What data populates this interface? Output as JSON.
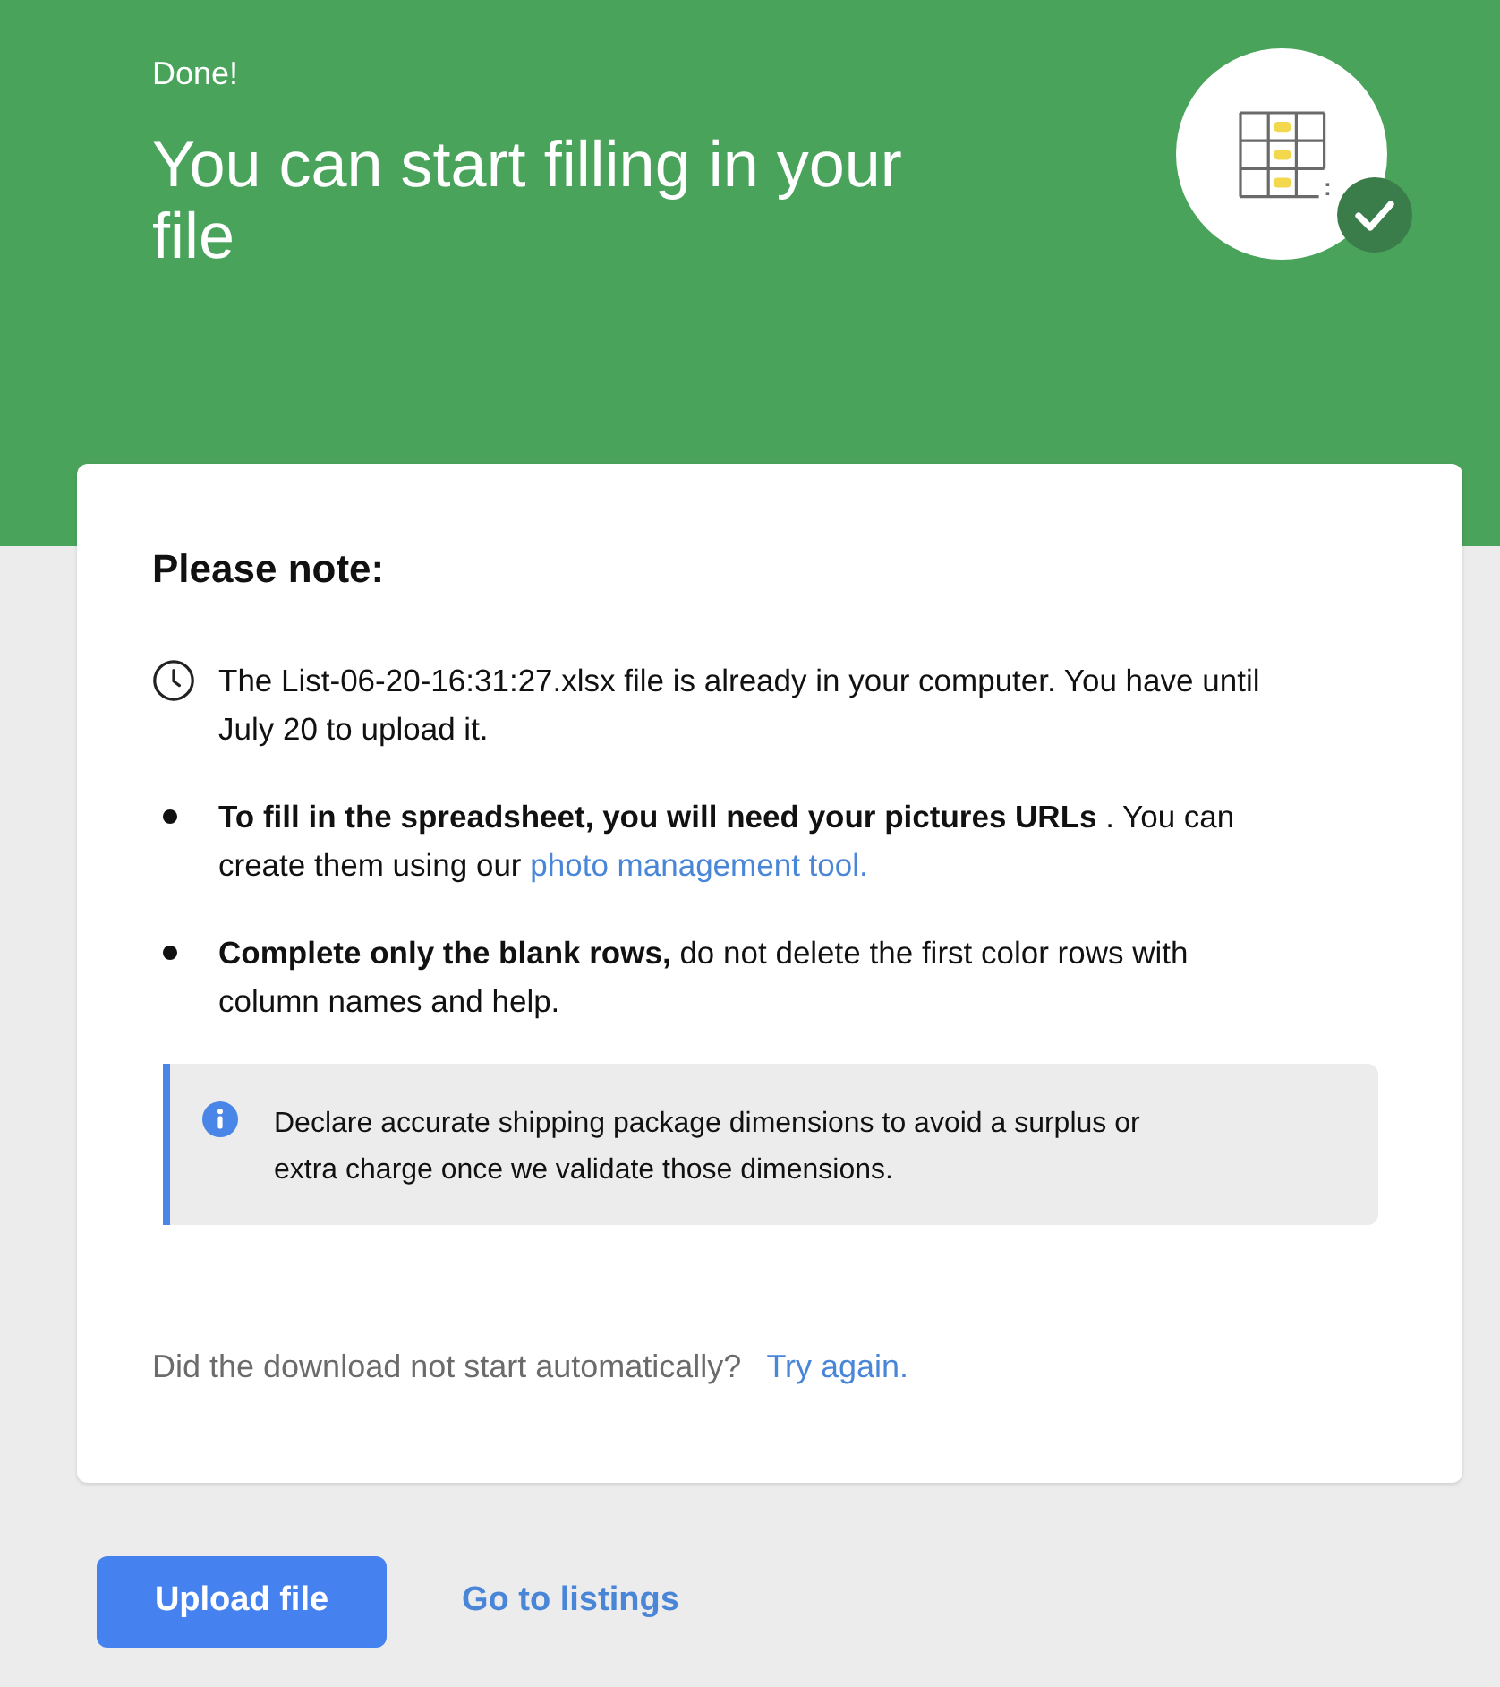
{
  "header": {
    "status": "Done!",
    "title": "You can start filling in your file"
  },
  "card": {
    "heading": "Please note:",
    "items": [
      {
        "kind": "clock",
        "text": "The List-06-20-16:31:27.xlsx file is already in your computer. You have until July 20 to upload it."
      },
      {
        "kind": "bullet",
        "text": "**To fill in the spreadsheet, you will need your pictures URLs** . You can create them using our",
        "link": "photo management tool."
      },
      {
        "kind": "bullet",
        "text": "**Complete only the blank rows,** do not delete the first color rows with column names and help."
      }
    ],
    "notice": {
      "kind": "info",
      "text": "Declare accurate shipping package dimensions to avoid a surplus or extra charge once we validate those dimensions."
    },
    "retry": {
      "question": "Did the download not start automatically?",
      "link": "Try again."
    }
  },
  "actions": [
    {
      "kind": "primary",
      "label": "Upload file"
    },
    {
      "kind": "link",
      "label": "Go to listings"
    }
  ]
}
